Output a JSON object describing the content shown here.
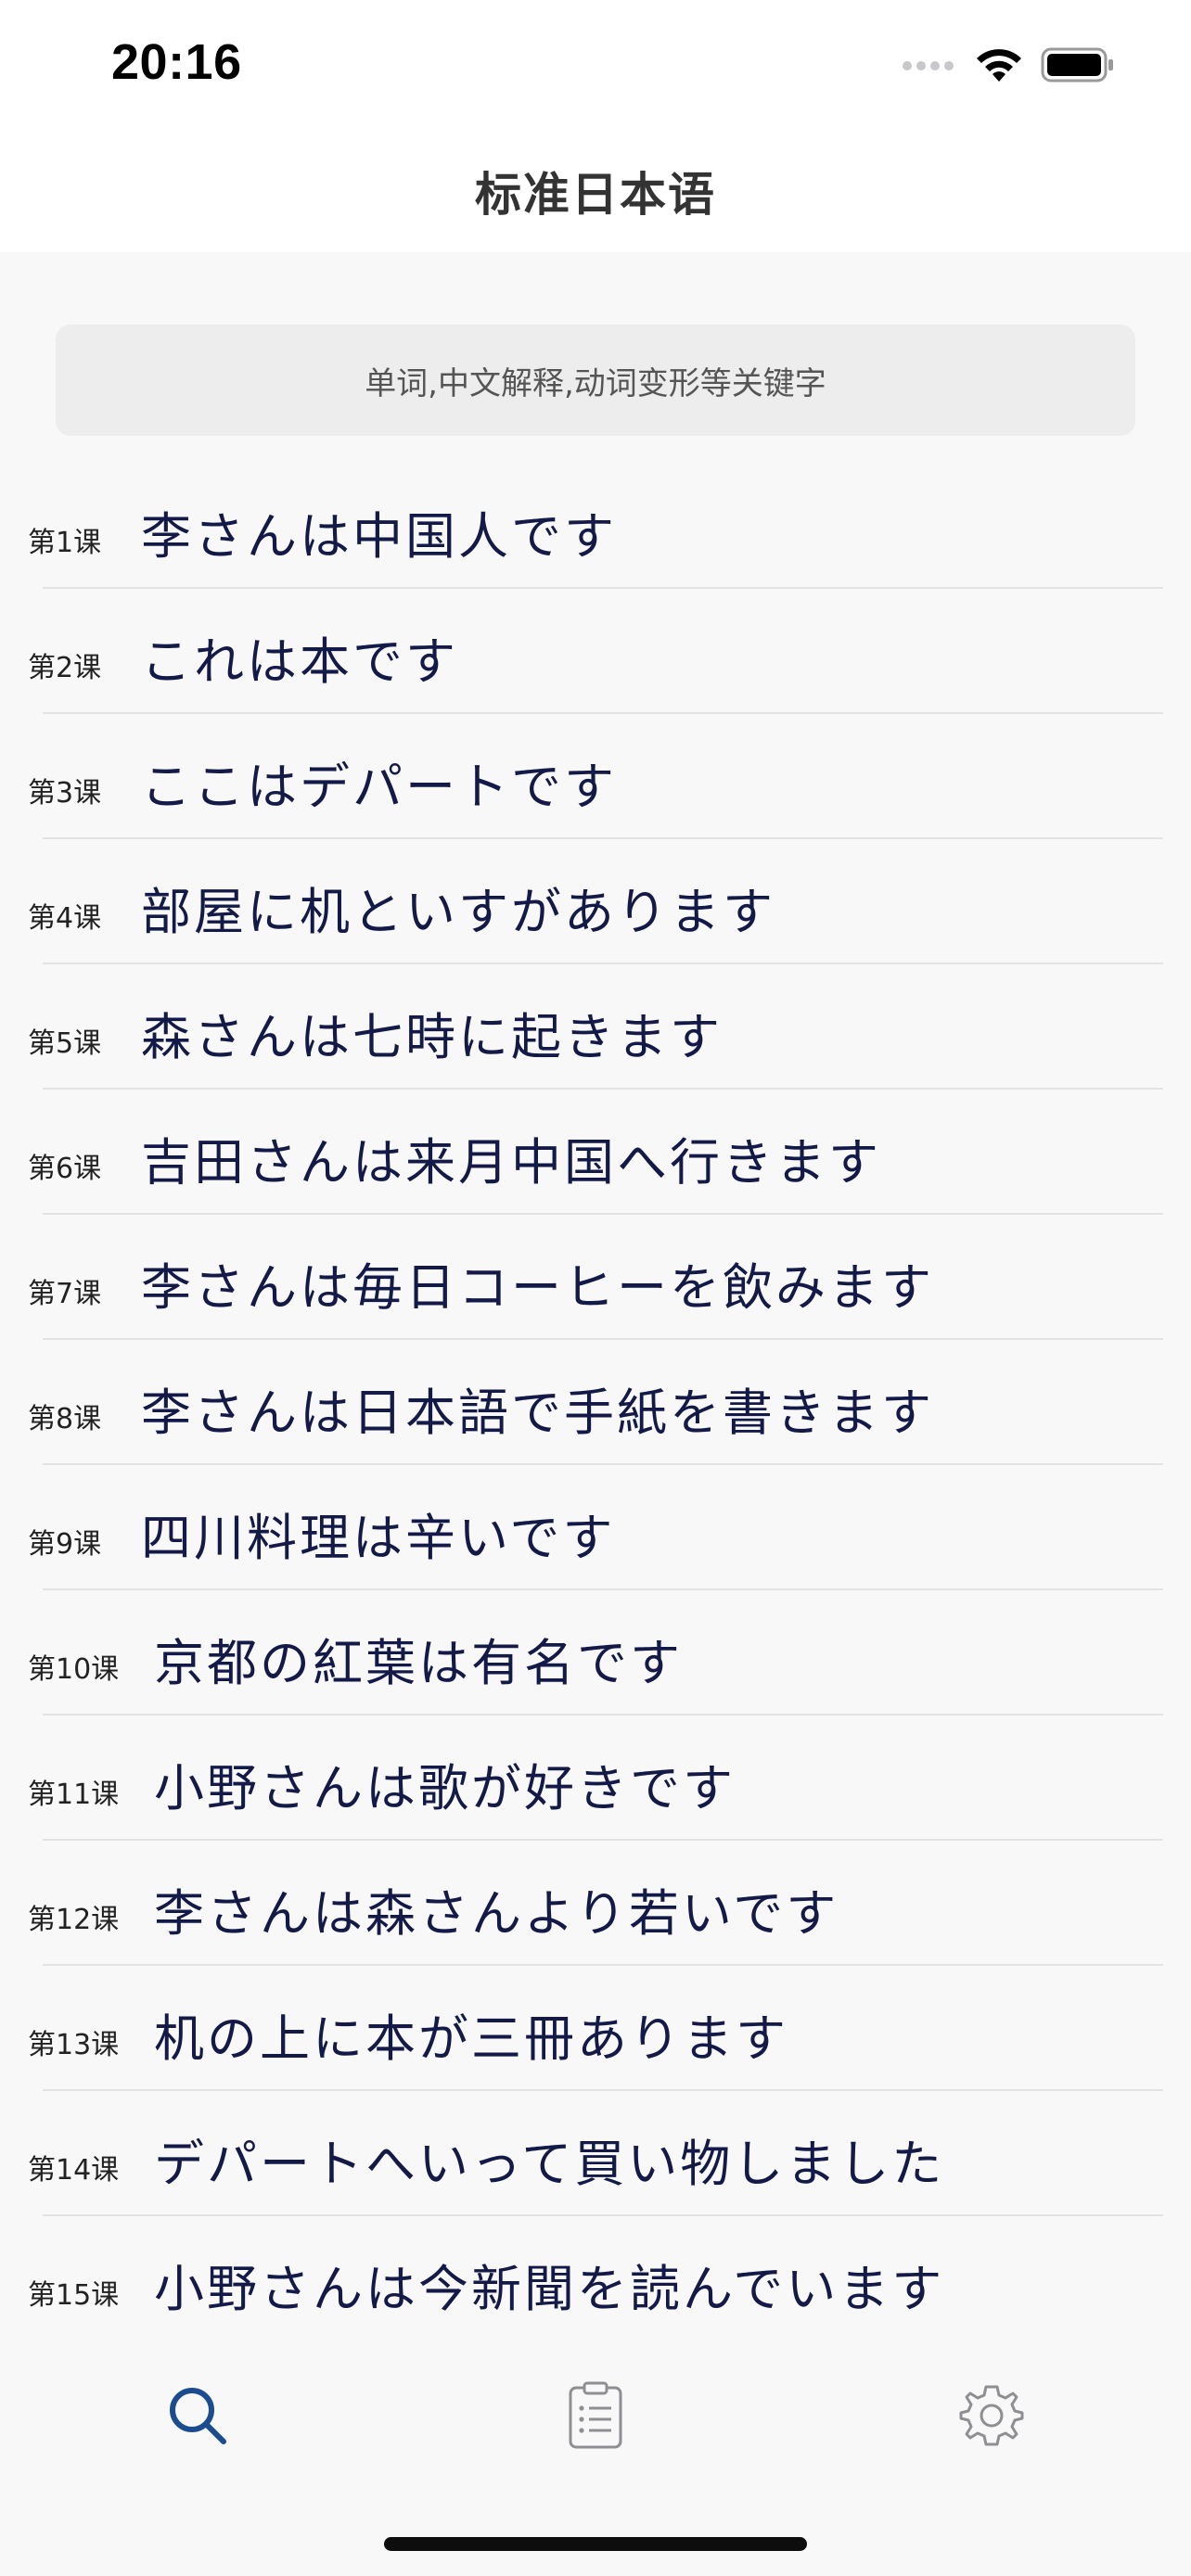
{
  "status_bar": {
    "time": "20:16",
    "icons": [
      "signal-icon",
      "wifi-icon",
      "battery-icon"
    ]
  },
  "nav": {
    "title": "标准日本语"
  },
  "search": {
    "placeholder": "单词,中文解释,动词变形等关键字"
  },
  "lessons": [
    {
      "number": "第1课",
      "title": "李さんは中国人です"
    },
    {
      "number": "第2课",
      "title": "これは本です"
    },
    {
      "number": "第3课",
      "title": "ここはデパートです"
    },
    {
      "number": "第4课",
      "title": "部屋に机といすがあります"
    },
    {
      "number": "第5课",
      "title": "森さんは七時に起きます"
    },
    {
      "number": "第6课",
      "title": "吉田さんは来月中国へ行きます"
    },
    {
      "number": "第7课",
      "title": "李さんは毎日コーヒーを飲みます"
    },
    {
      "number": "第8课",
      "title": "李さんは日本語で手紙を書きます"
    },
    {
      "number": "第9课",
      "title": "四川料理は辛いです"
    },
    {
      "number": "第10课",
      "title": "京都の紅葉は有名です"
    },
    {
      "number": "第11课",
      "title": "小野さんは歌が好きです"
    },
    {
      "number": "第12课",
      "title": "李さんは森さんより若いです"
    },
    {
      "number": "第13课",
      "title": "机の上に本が三冊あります"
    },
    {
      "number": "第14课",
      "title": "デパートへいって買い物しました"
    },
    {
      "number": "第15课",
      "title": "小野さんは今新聞を読んでいます"
    }
  ],
  "tabs": [
    {
      "icon": "search-icon",
      "active": true
    },
    {
      "icon": "clipboard-list-icon",
      "active": false
    },
    {
      "icon": "gear-icon",
      "active": false
    }
  ],
  "colors": {
    "accent": "#1a4c8f",
    "lesson_title": "#141a48",
    "inactive_icon": "#8e8e93"
  }
}
